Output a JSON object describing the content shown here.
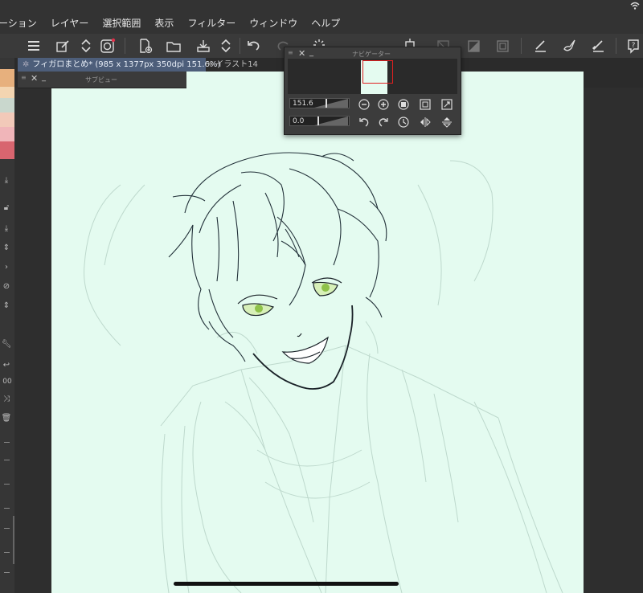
{
  "menu": {
    "items": [
      "ーション",
      "レイヤー",
      "選択範囲",
      "表示",
      "フィルター",
      "ウィンドウ",
      "ヘルプ"
    ]
  },
  "tabs": {
    "active_label": "フィガロまとめ* (985 x 1377px 350dpi 151.6%)",
    "inactive_label": "イラスト14"
  },
  "subview": {
    "title": "サブビュー"
  },
  "navigator": {
    "title": "ナビゲーター",
    "zoom_value": "151.6",
    "rotation_value": "0.0"
  },
  "left_rail": {
    "size_label": "00",
    "swatch_colors": [
      "#e7b07d",
      "#f3d5b1",
      "#c9d7cd",
      "#f2c9b9",
      "#f0b5b9",
      "#d8656f"
    ]
  },
  "colors": {
    "canvas_bg": "#e4fbf0",
    "tab_active": "#4d5e7a",
    "navigator_frame": "#e02020"
  }
}
